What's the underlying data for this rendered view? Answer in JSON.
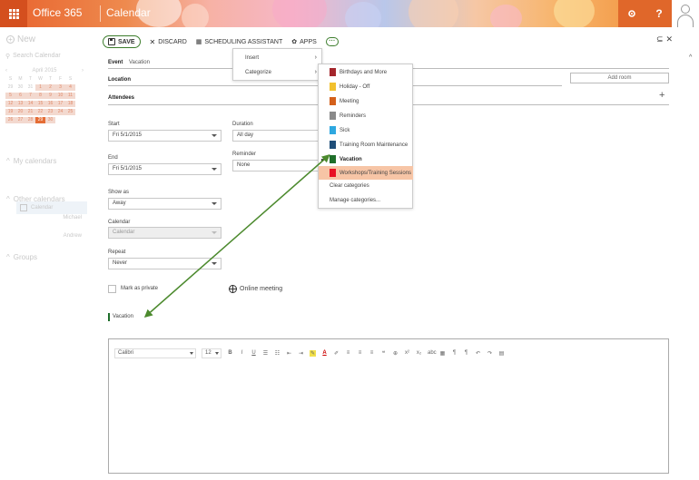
{
  "header": {
    "brand": "Office 365",
    "app": "Calendar",
    "settings_icon": "gear-icon",
    "help_label": "?",
    "accent_color": "#d44f1e"
  },
  "nav": {
    "new_label": "New",
    "search_placeholder": "Search Calendar",
    "minical": {
      "month": "April 2015",
      "weekdays": [
        "S",
        "M",
        "T",
        "W",
        "T",
        "F",
        "S"
      ],
      "days": [
        "29",
        "30",
        "31",
        "1",
        "2",
        "3",
        "4",
        "5",
        "6",
        "7",
        "8",
        "9",
        "10",
        "11",
        "12",
        "13",
        "14",
        "15",
        "16",
        "17",
        "18",
        "19",
        "20",
        "21",
        "22",
        "23",
        "24",
        "25",
        "26",
        "27",
        "28",
        "29",
        "30",
        "",
        ""
      ]
    },
    "my_calendars": "My calendars",
    "calendar_item": "Calendar",
    "other_calendars": "Other calendars",
    "other_1": "Michael",
    "other_2": "Andrew",
    "groups": "Groups"
  },
  "toolbar": {
    "save": "SAVE",
    "discard": "DISCARD",
    "scheduling": "SCHEDULING ASSISTANT",
    "apps": "APPS",
    "more": "···"
  },
  "form": {
    "event_label": "Event",
    "event_value": "Vacation",
    "location_label": "Location",
    "add_room": "Add room",
    "attendees_label": "Attendees",
    "start_label": "Start",
    "start_value": "Fri 5/1/2015",
    "duration_label": "Duration",
    "duration_value": "All day",
    "end_label": "End",
    "end_value": "Fri 5/1/2015",
    "reminder_label": "Reminder",
    "reminder_value": "None",
    "showas_label": "Show as",
    "showas_value": "Away",
    "calendar_label": "Calendar",
    "calendar_value": "Calendar",
    "repeat_label": "Repeat",
    "repeat_value": "Never",
    "private_label": "Mark as private",
    "online_meeting": "Online meeting",
    "category_tag": "Vacation",
    "category_color": "#1e6e2a"
  },
  "editor": {
    "font": "Calibri",
    "size": "12"
  },
  "menu": {
    "insert": "Insert",
    "categorize": "Categorize"
  },
  "categories": [
    {
      "label": "Birthdays and More",
      "color": "#a4262c"
    },
    {
      "label": "Holiday - Off",
      "color": "#f2c12e"
    },
    {
      "label": "Meeting",
      "color": "#d4601b"
    },
    {
      "label": "Reminders",
      "color": "#8a8a8a"
    },
    {
      "label": "Sick",
      "color": "#2ea8e0"
    },
    {
      "label": "Training Room Maintenance",
      "color": "#1f4e79"
    },
    {
      "label": "Vacation",
      "color": "#1e6e2a"
    },
    {
      "label": "Workshops/Training Sessions",
      "color": "#e81123"
    }
  ],
  "category_actions": {
    "clear": "Clear categories",
    "manage": "Manage categories..."
  }
}
